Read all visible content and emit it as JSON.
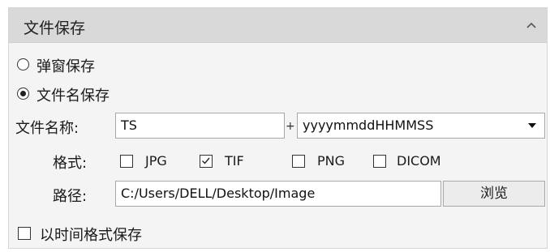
{
  "panel": {
    "title": "文件保存",
    "collapse_icon": "chevron-up-icon"
  },
  "save_mode": {
    "options": [
      {
        "label": "弹窗保存",
        "selected": false
      },
      {
        "label": "文件名保存",
        "selected": true
      }
    ]
  },
  "filename": {
    "label": "文件名称:",
    "value": "TS",
    "separator": "+",
    "format_selected": "yyyymmddHHMMSS"
  },
  "format": {
    "label": "格式:",
    "options": [
      {
        "label": "JPG",
        "checked": false
      },
      {
        "label": "TIF",
        "checked": true
      },
      {
        "label": "PNG",
        "checked": false
      },
      {
        "label": "DICOM",
        "checked": false
      }
    ]
  },
  "path": {
    "label": "路径:",
    "value": "C:/Users/DELL/Desktop/Image",
    "browse_label": "浏览"
  },
  "time_format_save": {
    "label": "以时间格式保存",
    "checked": false
  }
}
